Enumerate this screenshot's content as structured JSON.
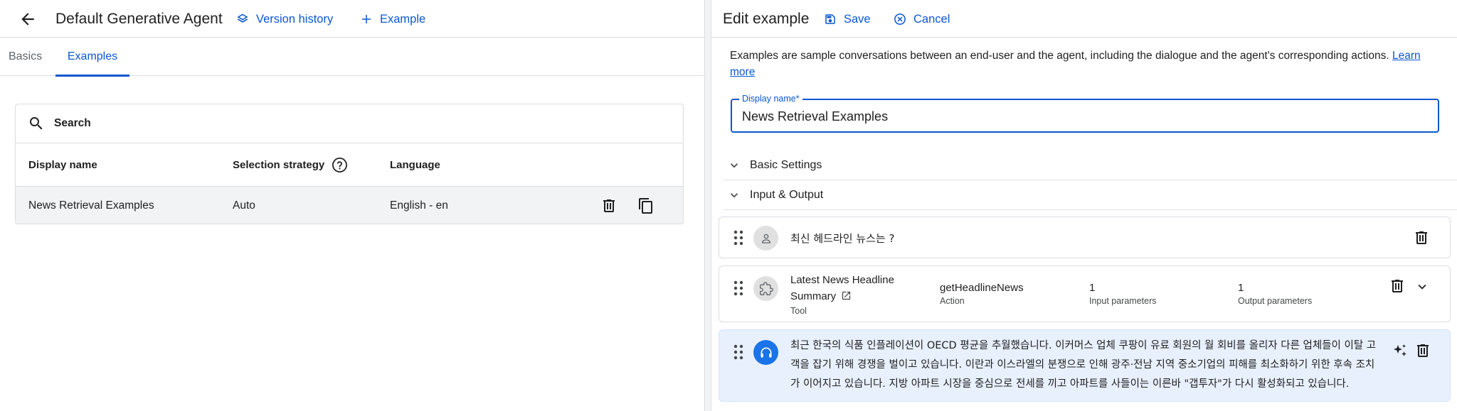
{
  "left": {
    "agent_title": "Default Generative Agent",
    "version_history": "Version history",
    "add_example": "Example",
    "tabs": [
      "Basics",
      "Examples"
    ],
    "search_placeholder": "Search",
    "columns": [
      "Display name",
      "Selection strategy",
      "Language"
    ],
    "rows": [
      {
        "display_name": "News Retrieval Examples",
        "strategy": "Auto",
        "language": "English - en"
      }
    ]
  },
  "right": {
    "title": "Edit example",
    "save": "Save",
    "cancel": "Cancel",
    "intro": "Examples are sample conversations between an end-user and the agent, including the dialogue and the agent's corresponding actions.",
    "learn_more": "Learn more",
    "display_name_label": "Display name*",
    "display_name_value": "News Retrieval Examples",
    "sections": [
      "Basic Settings",
      "Input & Output"
    ],
    "user_message": "최신 헤드라인 뉴스는 ?",
    "tool": {
      "name": "Latest News Headline Summary",
      "type": "Tool",
      "action": "getHeadlineNews",
      "action_label": "Action",
      "input_count": "1",
      "input_label": "Input parameters",
      "output_count": "1",
      "output_label": "Output parameters"
    },
    "agent_message": "최근 한국의 식품 인플레이션이 OECD 평균을 추월했습니다. 이커머스 업체 쿠팡이 유료 회원의 월 회비를 올리자 다른 업체들이 이탈 고객을 잡기 위해 경쟁을 벌이고 있습니다. 이란과 이스라엘의 분쟁으로 인해 광주·전남 지역 중소기업의 피해를 최소화하기 위한 후속 조치가 이어지고 있습니다. 지방 아파트 시장을 중심으로 전세를 끼고 아파트를 사들이는 이른바 \"갭투자\"가 다시 활성화되고 있습니다."
  },
  "colors": {
    "accent": "#0b57d0",
    "agent_bg": "#e8f0fe",
    "avatar_blue": "#1a73e8"
  }
}
